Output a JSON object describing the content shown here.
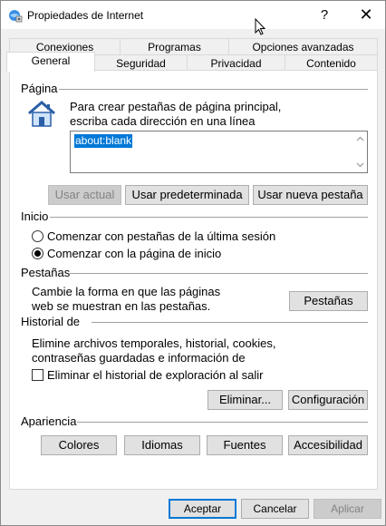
{
  "window": {
    "title": "Propiedades de Internet",
    "help_glyph": "?",
    "close_glyph": "✕"
  },
  "tabs": {
    "row1": [
      "Conexiones",
      "Programas",
      "Opciones avanzadas"
    ],
    "row2": [
      "General",
      "Seguridad",
      "Privacidad",
      "Contenido"
    ],
    "active": "General"
  },
  "home_page": {
    "section": "Página",
    "instructions_line1": "Para crear pestañas de página principal,",
    "instructions_line2": "escriba cada dirección en una línea",
    "address_value": "about:blank",
    "use_current": "Usar actual",
    "use_default": "Usar predeterminada",
    "use_new_tab": "Usar nueva pestaña"
  },
  "startup": {
    "section": "Inicio",
    "option_last_session": "Comenzar con pestañas de la última sesión",
    "option_home_page": "Comenzar con la página de inicio",
    "selected": "option_home_page"
  },
  "tabs_section": {
    "section": "Pestañas",
    "description_line1": "Cambie la forma en que las páginas",
    "description_line2": "web se muestran en las pestañas.",
    "button": "Pestañas"
  },
  "history": {
    "section": "Historial de exploración",
    "description_line1": "Elimine archivos temporales, historial, cookies,",
    "description_line2": "contraseñas guardadas e información de",
    "delete_on_exit_label": "Eliminar el historial de exploración al salir",
    "delete_on_exit_checked": false,
    "delete_button": "Eliminar...",
    "settings_button": "Configuración"
  },
  "appearance": {
    "section": "Apariencia",
    "colors": "Colores",
    "languages": "Idiomas",
    "fonts": "Fuentes",
    "accessibility": "Accesibilidad"
  },
  "footer": {
    "ok": "Aceptar",
    "cancel": "Cancelar",
    "apply": "Aplicar"
  },
  "colors": {
    "accent": "#0078d7",
    "selection_bg": "#0078d7"
  }
}
